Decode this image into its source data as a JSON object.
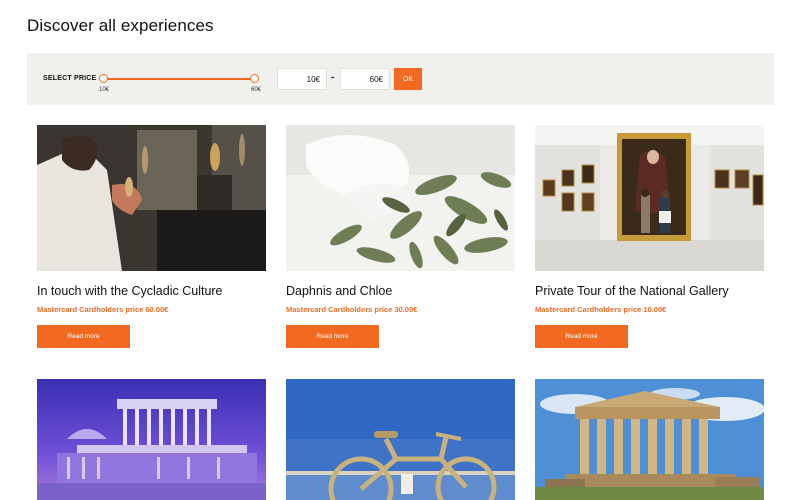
{
  "page": {
    "title": "Discover all experiences"
  },
  "filter": {
    "label": "SELECT PRICE",
    "slider_min_label": "10€",
    "slider_max_label": "60€",
    "slider_low_fraction": 0,
    "slider_high_fraction": 1,
    "min_value": "10€",
    "max_value": "60€",
    "separator": "-",
    "ok_label": "OK"
  },
  "colors": {
    "accent": "#f26a22",
    "filter_bg": "#f1f0ed"
  },
  "cards": [
    {
      "title": "In touch with the Cycladic Culture",
      "price": "Mastercard Cardholders price 60.00€",
      "button": "Read more"
    },
    {
      "title": "Daphnis and Chloe",
      "price": "Mastercard Cardholders price 30.00€",
      "button": "Read more"
    },
    {
      "title": "Private Tour of the National Gallery",
      "price": "Mastercard Cardholders price 10.00€",
      "button": "Read more"
    }
  ]
}
